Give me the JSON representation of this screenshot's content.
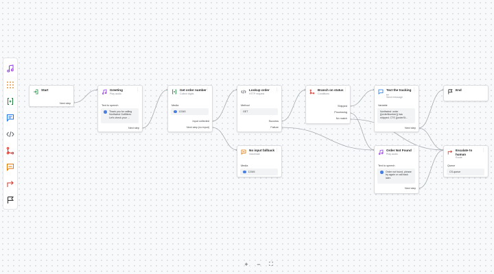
{
  "palette": [
    {
      "name": "play-audio",
      "icon": "music-note-icon",
      "color": "#9334e6"
    },
    {
      "name": "collect-digits",
      "icon": "dial-pad-icon",
      "color": "#e37400"
    },
    {
      "name": "set-variable",
      "icon": "variable-brackets-icon",
      "color": "#188038"
    },
    {
      "name": "send-message",
      "icon": "message-icon",
      "color": "#1a73e8"
    },
    {
      "name": "http-request",
      "icon": "code-icon",
      "color": "#5f6368"
    },
    {
      "name": "branch-conditions",
      "icon": "branch-icon",
      "color": "#d93025"
    },
    {
      "name": "voicemail",
      "icon": "voicemail-icon",
      "color": "#e37400"
    },
    {
      "name": "transfer",
      "icon": "transfer-arrow-icon",
      "color": "#d93025"
    },
    {
      "name": "end",
      "icon": "flag-icon",
      "color": "#202124"
    }
  ],
  "nodes": {
    "start": {
      "title": "Start",
      "port_next": "Next step"
    },
    "greeting": {
      "title": "Greeting",
      "subtitle": "Play audio",
      "field_label": "Text to speech",
      "tts": "Thank you for calling Northwind Outfitters. Let's check your ...",
      "port_next": "Next step"
    },
    "get_order": {
      "title": "Get order number",
      "subtitle": "Collect digits",
      "field_label": "Media",
      "media": "12345",
      "port_collected": "Input collected",
      "port_noinput": "Next step (no input)"
    },
    "lookup": {
      "title": "Lookup order",
      "subtitle": "HTTP request",
      "field_label": "Method",
      "method": "GET",
      "port_success": "Success",
      "port_failure": "Failure"
    },
    "branch": {
      "title": "Branch on status",
      "subtitle": "Conditions",
      "port_shipped": "Shipped",
      "port_processing": "Processing",
      "port_nomatch": "No match"
    },
    "text_tracking": {
      "title": "Text the tracking ...",
      "subtitle": "Send message",
      "field_label": "Variable",
      "variable": "Northwind: order {{orderNumber}} has shipped. CTS {{orderSt...",
      "port_next": "Next step"
    },
    "end": {
      "title": "End"
    },
    "no_input": {
      "title": "No input fallback",
      "subtitle": "Voicemail",
      "field_label": "Media",
      "media": "12345"
    },
    "not_found": {
      "title": "Order Not Found",
      "subtitle": "Play audio",
      "field_label": "Text to speech",
      "tts": "Order not found, please try again or call back later.",
      "port_next": "Next step"
    },
    "escalate": {
      "title": "Escalate to human",
      "subtitle": "Route",
      "field_label": "Queue",
      "queue": "CS-queue"
    }
  },
  "controls": {
    "zoom_in": "+",
    "zoom_out": "−",
    "fit": "⛶"
  }
}
